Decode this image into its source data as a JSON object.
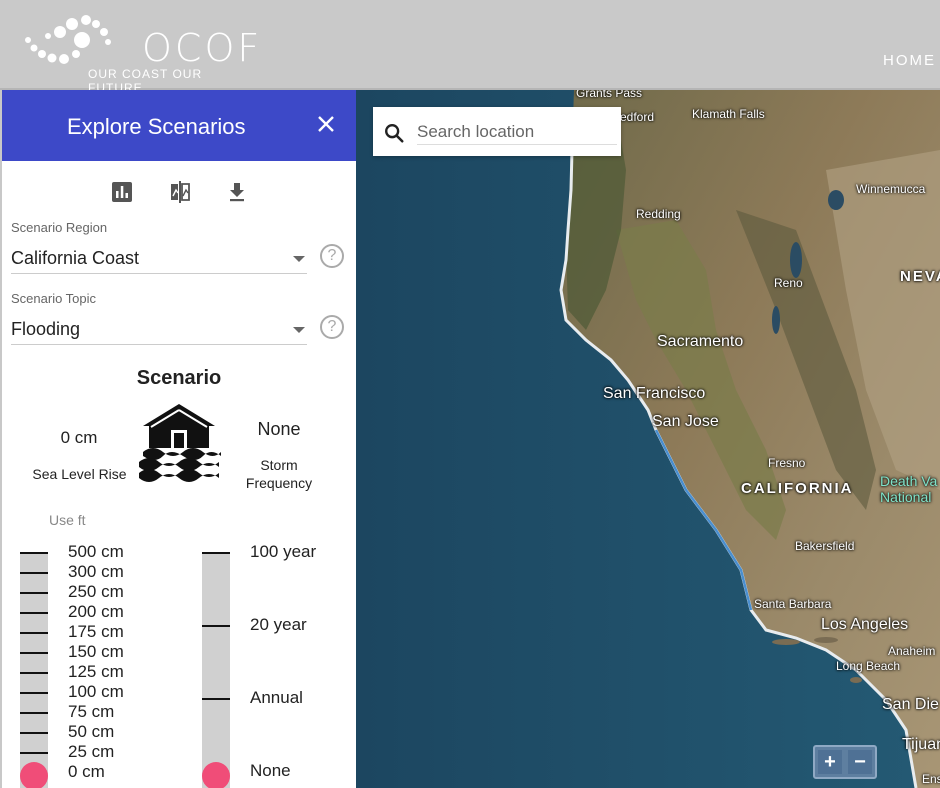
{
  "header": {
    "logo_text": "OCOF",
    "logo_tagline": "OUR COAST OUR FUTURE",
    "nav_home": "HOME"
  },
  "panel": {
    "title": "Explore Scenarios",
    "close_icon": "close-icon",
    "toolbar_icons": [
      "bar-chart-icon",
      "compare-icon",
      "download-icon"
    ],
    "region_label": "Scenario Region",
    "region_value": "California Coast",
    "topic_label": "Scenario Topic",
    "topic_value": "Flooding",
    "help_glyph": "?",
    "scenario_title": "Scenario",
    "sea_level_value": "0 cm",
    "sea_level_label": "Sea Level Rise",
    "storm_value": "None",
    "storm_label": "Storm Frequency",
    "flood_icon": "flooded-house-icon",
    "use_ft": "Use ft",
    "slr_options": [
      "500 cm",
      "300 cm",
      "250 cm",
      "200 cm",
      "175 cm",
      "150 cm",
      "125 cm",
      "100 cm",
      "75 cm",
      "50 cm",
      "25 cm",
      "0 cm"
    ],
    "slr_selected": "0 cm",
    "storm_options": [
      "100 year",
      "20 year",
      "Annual",
      "None"
    ],
    "storm_selected": "None"
  },
  "map": {
    "search_placeholder": "Search location",
    "search_icon": "search-icon",
    "zoom_in": "+",
    "zoom_out": "−",
    "labels": {
      "grants_pass": "Grants Pass",
      "medford": "edford",
      "klamath_falls": "Klamath Falls",
      "winnemucca": "Winnemucca",
      "redding": "Redding",
      "reno": "Reno",
      "nevada": "NEVA",
      "sacramento": "Sacramento",
      "san_francisco": "San Francisco",
      "san_jose": "San Jose",
      "fresno": "Fresno",
      "california": "CALIFORNIA",
      "death_valley_1": "Death Va",
      "death_valley_2": "National",
      "bakersfield": "Bakersfield",
      "santa_barbara": "Santa Barbara",
      "los_angeles": "Los Angeles",
      "anaheim": "Anaheim",
      "long_beach": "Long Beach",
      "san_diego": "San Die",
      "tijuana": "Tijuan",
      "ens": "Ens"
    }
  },
  "colors": {
    "panel_header": "#3d49c8",
    "slider_handle": "#f04d78",
    "header_bg": "#c9c9c9"
  }
}
